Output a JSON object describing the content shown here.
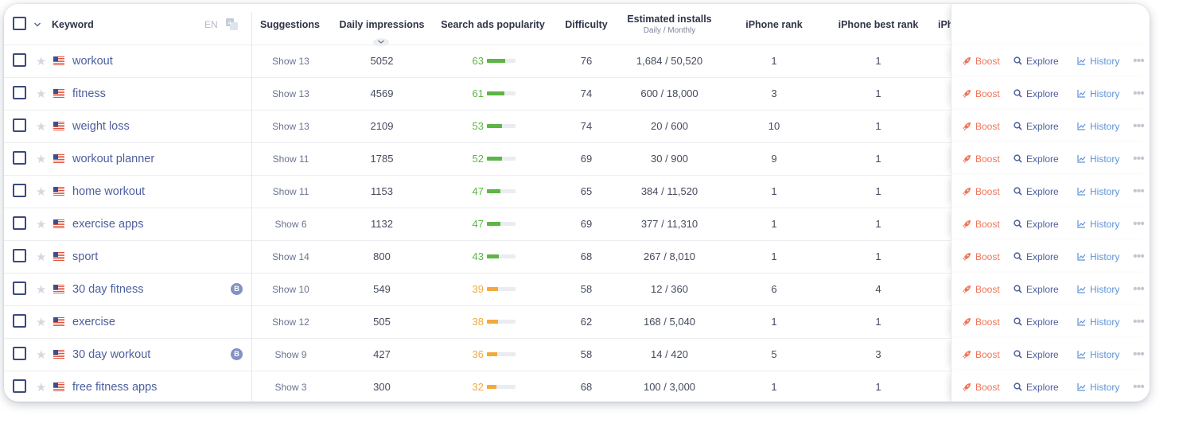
{
  "header": {
    "keyword": "Keyword",
    "lang": "EN",
    "suggestions": "Suggestions",
    "daily_impressions": "Daily impressions",
    "search_ads_popularity": "Search ads popularity",
    "difficulty": "Difficulty",
    "estimated_installs": "Estimated installs",
    "estimated_installs_sub": "Daily / Monthly",
    "iphone_rank": "iPhone rank",
    "iphone_best_rank": "iPhone best rank",
    "clipped": "iPh"
  },
  "actions": {
    "boost": "Boost",
    "explore": "Explore",
    "history": "History",
    "more": "•••"
  },
  "colors": {
    "accent": "#4d5f9e",
    "pop_green": "#5cb545",
    "pop_orange": "#f2a93b",
    "boost": "#f07457",
    "history": "#5f93d8"
  },
  "icons": {
    "sort": "chevron-down-icon",
    "translate": "translate-icon",
    "star": "star-icon",
    "flag": "us-flag-icon",
    "boost": "rocket-icon",
    "explore": "search-icon",
    "history": "chart-icon",
    "more": "more-dots-icon"
  },
  "rows": [
    {
      "keyword": "workout",
      "suggestions": "Show 13",
      "impressions": "5052",
      "popularity": 63,
      "pop_label": "63",
      "difficulty": "76",
      "installs": "1,684 / 50,520",
      "rank": "1",
      "best_rank": "1",
      "badge": ""
    },
    {
      "keyword": "fitness",
      "suggestions": "Show 13",
      "impressions": "4569",
      "popularity": 61,
      "pop_label": "61",
      "difficulty": "74",
      "installs": "600 / 18,000",
      "rank": "3",
      "best_rank": "1",
      "badge": ""
    },
    {
      "keyword": "weight loss",
      "suggestions": "Show 13",
      "impressions": "2109",
      "popularity": 53,
      "pop_label": "53",
      "difficulty": "74",
      "installs": "20 / 600",
      "rank": "10",
      "best_rank": "1",
      "badge": ""
    },
    {
      "keyword": "workout planner",
      "suggestions": "Show 11",
      "impressions": "1785",
      "popularity": 52,
      "pop_label": "52",
      "difficulty": "69",
      "installs": "30 / 900",
      "rank": "9",
      "best_rank": "1",
      "badge": ""
    },
    {
      "keyword": "home workout",
      "suggestions": "Show 11",
      "impressions": "1153",
      "popularity": 47,
      "pop_label": "47",
      "difficulty": "65",
      "installs": "384 / 11,520",
      "rank": "1",
      "best_rank": "1",
      "badge": ""
    },
    {
      "keyword": "exercise apps",
      "suggestions": "Show 6",
      "impressions": "1132",
      "popularity": 47,
      "pop_label": "47",
      "difficulty": "69",
      "installs": "377 / 11,310",
      "rank": "1",
      "best_rank": "1",
      "badge": ""
    },
    {
      "keyword": "sport",
      "suggestions": "Show 14",
      "impressions": "800",
      "popularity": 43,
      "pop_label": "43",
      "difficulty": "68",
      "installs": "267 / 8,010",
      "rank": "1",
      "best_rank": "1",
      "badge": ""
    },
    {
      "keyword": "30 day fitness",
      "suggestions": "Show 10",
      "impressions": "549",
      "popularity": 39,
      "pop_label": "39",
      "difficulty": "58",
      "installs": "12 / 360",
      "rank": "6",
      "best_rank": "4",
      "badge": "B"
    },
    {
      "keyword": "exercise",
      "suggestions": "Show 12",
      "impressions": "505",
      "popularity": 38,
      "pop_label": "38",
      "difficulty": "62",
      "installs": "168 / 5,040",
      "rank": "1",
      "best_rank": "1",
      "badge": ""
    },
    {
      "keyword": "30 day workout",
      "suggestions": "Show 9",
      "impressions": "427",
      "popularity": 36,
      "pop_label": "36",
      "difficulty": "58",
      "installs": "14 / 420",
      "rank": "5",
      "best_rank": "3",
      "badge": "B"
    },
    {
      "keyword": "free fitness apps",
      "suggestions": "Show 3",
      "impressions": "300",
      "popularity": 32,
      "pop_label": "32",
      "difficulty": "68",
      "installs": "100 / 3,000",
      "rank": "1",
      "best_rank": "1",
      "badge": ""
    }
  ]
}
